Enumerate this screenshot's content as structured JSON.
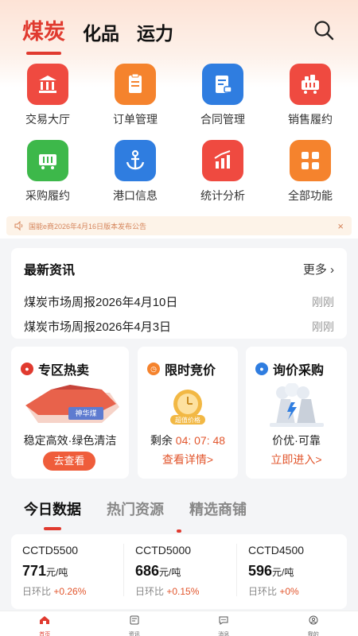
{
  "header": {
    "tabs": [
      "煤炭",
      "化品",
      "运力"
    ],
    "active_tab": 0
  },
  "grid": {
    "items": [
      {
        "label": "交易大厅",
        "icon": "exchange-hall-icon",
        "color": "#ef4a40"
      },
      {
        "label": "订单管理",
        "icon": "order-icon",
        "color": "#f5832d"
      },
      {
        "label": "合同管理",
        "icon": "contract-icon",
        "color": "#2f7de0"
      },
      {
        "label": "销售履约",
        "icon": "sales-cart-icon",
        "color": "#ef4a40"
      },
      {
        "label": "采购履约",
        "icon": "purchase-cart-icon",
        "color": "#3db84a"
      },
      {
        "label": "港口信息",
        "icon": "anchor-icon",
        "color": "#2f7de0"
      },
      {
        "label": "统计分析",
        "icon": "chart-icon",
        "color": "#ef4a40"
      },
      {
        "label": "全部功能",
        "icon": "all-functions-icon",
        "color": "#f5832d"
      }
    ]
  },
  "notice": {
    "text": "国能e商2026年4月16日版本发布公告",
    "close": "×"
  },
  "news": {
    "title": "最新资讯",
    "more": "更多",
    "items": [
      {
        "title": "煤炭市场周报2026年4月10日",
        "time": "刚刚"
      },
      {
        "title": "煤炭市场周报2026年4月3日",
        "time": "刚刚"
      }
    ]
  },
  "cards": {
    "hot": {
      "title": "专区热卖",
      "badge": "神华煤",
      "desc": "稳定高效·绿色清洁",
      "action": "去查看"
    },
    "auction": {
      "title": "限时竞价",
      "badge": "超值价格",
      "remain_label": "剩余",
      "remain_time": "04: 07: 48",
      "action": "查看详情>"
    },
    "inquiry": {
      "title": "询价采购",
      "desc": "价优·可靠",
      "action": "立即进入>"
    }
  },
  "data_tabs": [
    "今日数据",
    "热门资源",
    "精选商铺"
  ],
  "today_data": [
    {
      "name": "CCTD5500",
      "value": "771",
      "unit": "元/吨",
      "ratio_label": "日环比",
      "ratio": "+0.26%"
    },
    {
      "name": "CCTD5000",
      "value": "686",
      "unit": "元/吨",
      "ratio_label": "日环比",
      "ratio": "+0.15%"
    },
    {
      "name": "CCTD4500",
      "value": "596",
      "unit": "元/吨",
      "ratio_label": "日环比",
      "ratio": "+0%"
    }
  ],
  "bottom_nav": [
    {
      "label": "首页",
      "icon": "home-icon"
    },
    {
      "label": "资讯",
      "icon": "news-icon"
    },
    {
      "label": "消息",
      "icon": "message-icon"
    },
    {
      "label": "我的",
      "icon": "profile-icon"
    }
  ],
  "colors": {
    "accent": "#e03a2f",
    "orange": "#e2562d"
  }
}
